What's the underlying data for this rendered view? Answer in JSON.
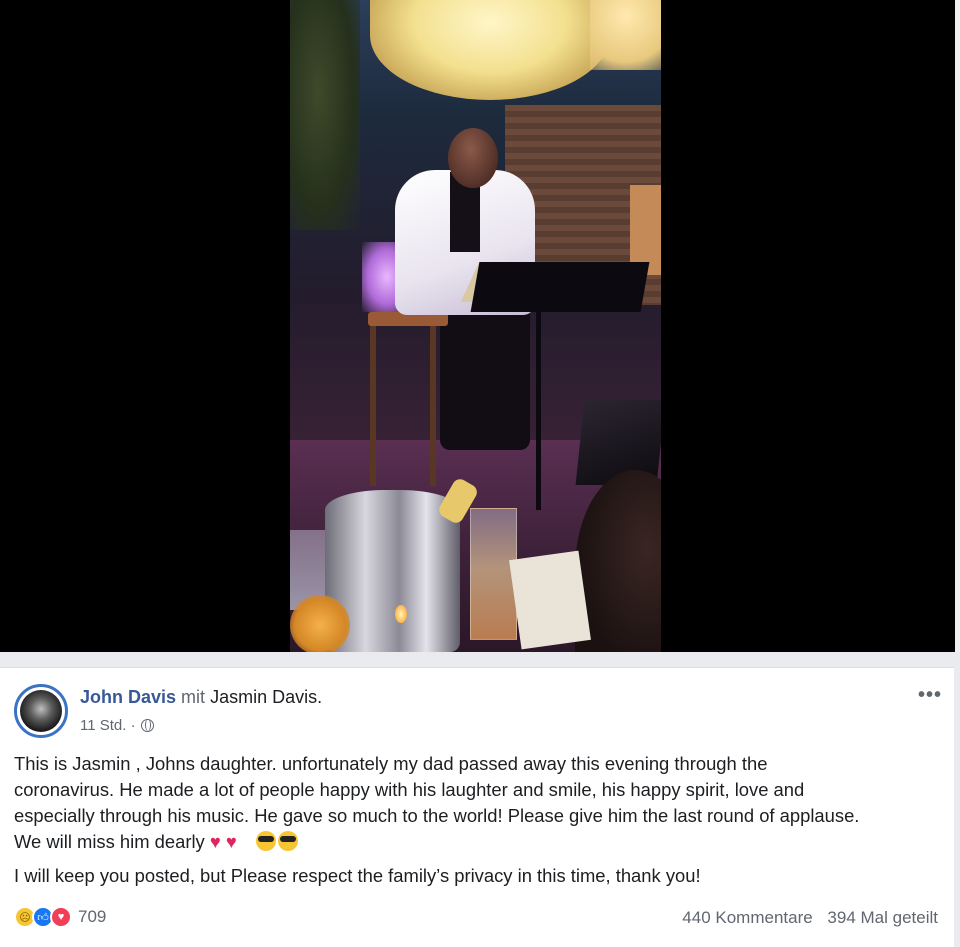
{
  "post": {
    "author": "John Davis",
    "with_word": "mit",
    "tagged": "Jasmin Davis.",
    "time": "11 Std. ·",
    "more_label": "•••",
    "paragraph1_line1": "This is Jasmin , Johns daughter.    unfortunately my dad passed away this evening through the",
    "paragraph1_line2": "coronavirus. He made a lot of people happy with his laughter and smile, his happy spirit, love and",
    "paragraph1_line3": "especially through his music. He gave so much to the world! Please give him the last round of applause.",
    "paragraph1_line4": "We will miss him dearly",
    "hearts": "♥ ♥",
    "paragraph2": "I will keep you posted, but Please respect the family’s privacy in this time, thank you!",
    "reaction_count": "709",
    "comments": "440 Kommentare",
    "shares": "394 Mal geteilt"
  },
  "icons": {
    "privacy": "globe-icon",
    "reactions": [
      "sad-reaction-icon",
      "like-reaction-icon",
      "love-reaction-icon"
    ],
    "menu": "more-options-icon"
  },
  "colors": {
    "author_link": "#385898",
    "like_blue": "#1877f2",
    "love_red": "#f33e58",
    "sad_yellow": "#f7c531"
  }
}
